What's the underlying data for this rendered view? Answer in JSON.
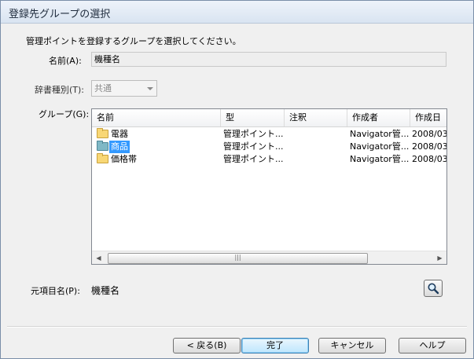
{
  "window": {
    "title": "登録先グループの選択"
  },
  "instruction": "管理ポイントを登録するグループを選択してください。",
  "name_field": {
    "label": "名前(A):",
    "value": "機種名"
  },
  "dictionary_type": {
    "label": "辞書種別(T):",
    "selected": "共通"
  },
  "group": {
    "label": "グループ(G):",
    "columns": [
      "名前",
      "型",
      "注釈",
      "作成者",
      "作成日"
    ],
    "rows": [
      {
        "name": "電器",
        "type": "管理ポイント...",
        "note": "",
        "author": "Navigator管...",
        "date": "2008/03."
      },
      {
        "name": "商品",
        "type": "管理ポイント...",
        "note": "",
        "author": "Navigator管...",
        "date": "2008/03.",
        "selected": true
      },
      {
        "name": "価格帯",
        "type": "管理ポイント...",
        "note": "",
        "author": "Navigator管...",
        "date": "2008/03."
      }
    ],
    "scroll_grip": "|||"
  },
  "source_item": {
    "label": "元項目名(P):",
    "value": "機種名"
  },
  "buttons": {
    "back": "< 戻る(B)",
    "finish": "完了",
    "cancel": "キャンセル",
    "help": "ヘルプ"
  },
  "colors": {
    "selection": "#3399ff",
    "folder": "#f8d775",
    "title_text": "#1e2b3c"
  }
}
